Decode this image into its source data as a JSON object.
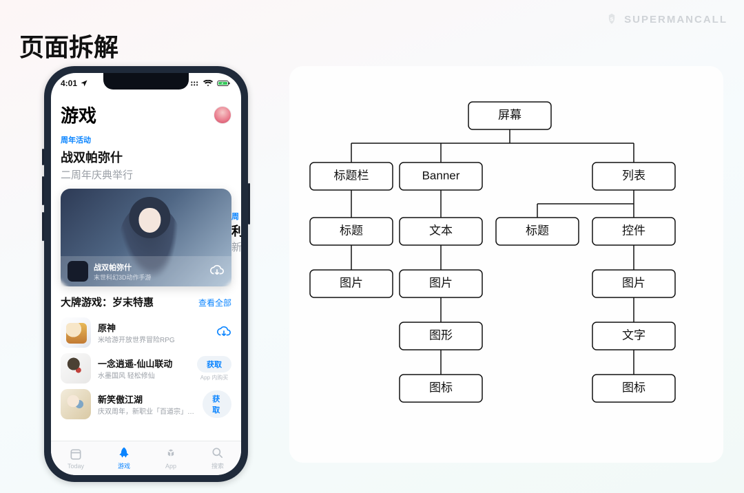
{
  "watermark": "SUPERMANCALL",
  "page_title": "页面拆解",
  "phone": {
    "status": {
      "time": "4:01",
      "location_on": true
    },
    "header": {
      "title": "游戏"
    },
    "feature": {
      "eyebrow": "周年活动",
      "heading": "战双帕弥什",
      "sub": "二周年庆典举行",
      "card": {
        "title": "战双帕弥什",
        "tagline": "末世科幻3D动作手游"
      },
      "peek": {
        "eyebrow": "周",
        "heading_head": "利",
        "sub_head": "新"
      }
    },
    "section": {
      "title": "大牌游戏：岁末特惠",
      "link": "查看全部"
    },
    "apps": [
      {
        "name": "原神",
        "desc": "米哈游开放世界冒险RPG",
        "action": "download"
      },
      {
        "name": "一念逍遥-仙山联动",
        "desc": "水墨国风 轻松修仙",
        "action": "get",
        "iap": "App 内购买"
      },
      {
        "name": "新笑傲江湖",
        "desc": "庆双周年，新职业「百道宗」登陆江湖",
        "action": "get"
      }
    ],
    "labels": {
      "get": "获取"
    },
    "tabs": [
      {
        "label": "Today"
      },
      {
        "label": "游戏"
      },
      {
        "label": "App"
      },
      {
        "label": "搜索"
      }
    ],
    "active_tab": 1
  },
  "diagram": {
    "root": "屏幕",
    "branches": {
      "titlebar": {
        "label": "标题栏",
        "children": [
          "标题",
          "图片"
        ]
      },
      "banner": {
        "label": "Banner",
        "children": [
          "文本",
          "图片",
          "图形",
          "图标"
        ]
      },
      "list": {
        "label": "列表",
        "left": "标题",
        "right_label": "控件",
        "right_children": [
          "图片",
          "文字",
          "图标"
        ]
      }
    }
  }
}
